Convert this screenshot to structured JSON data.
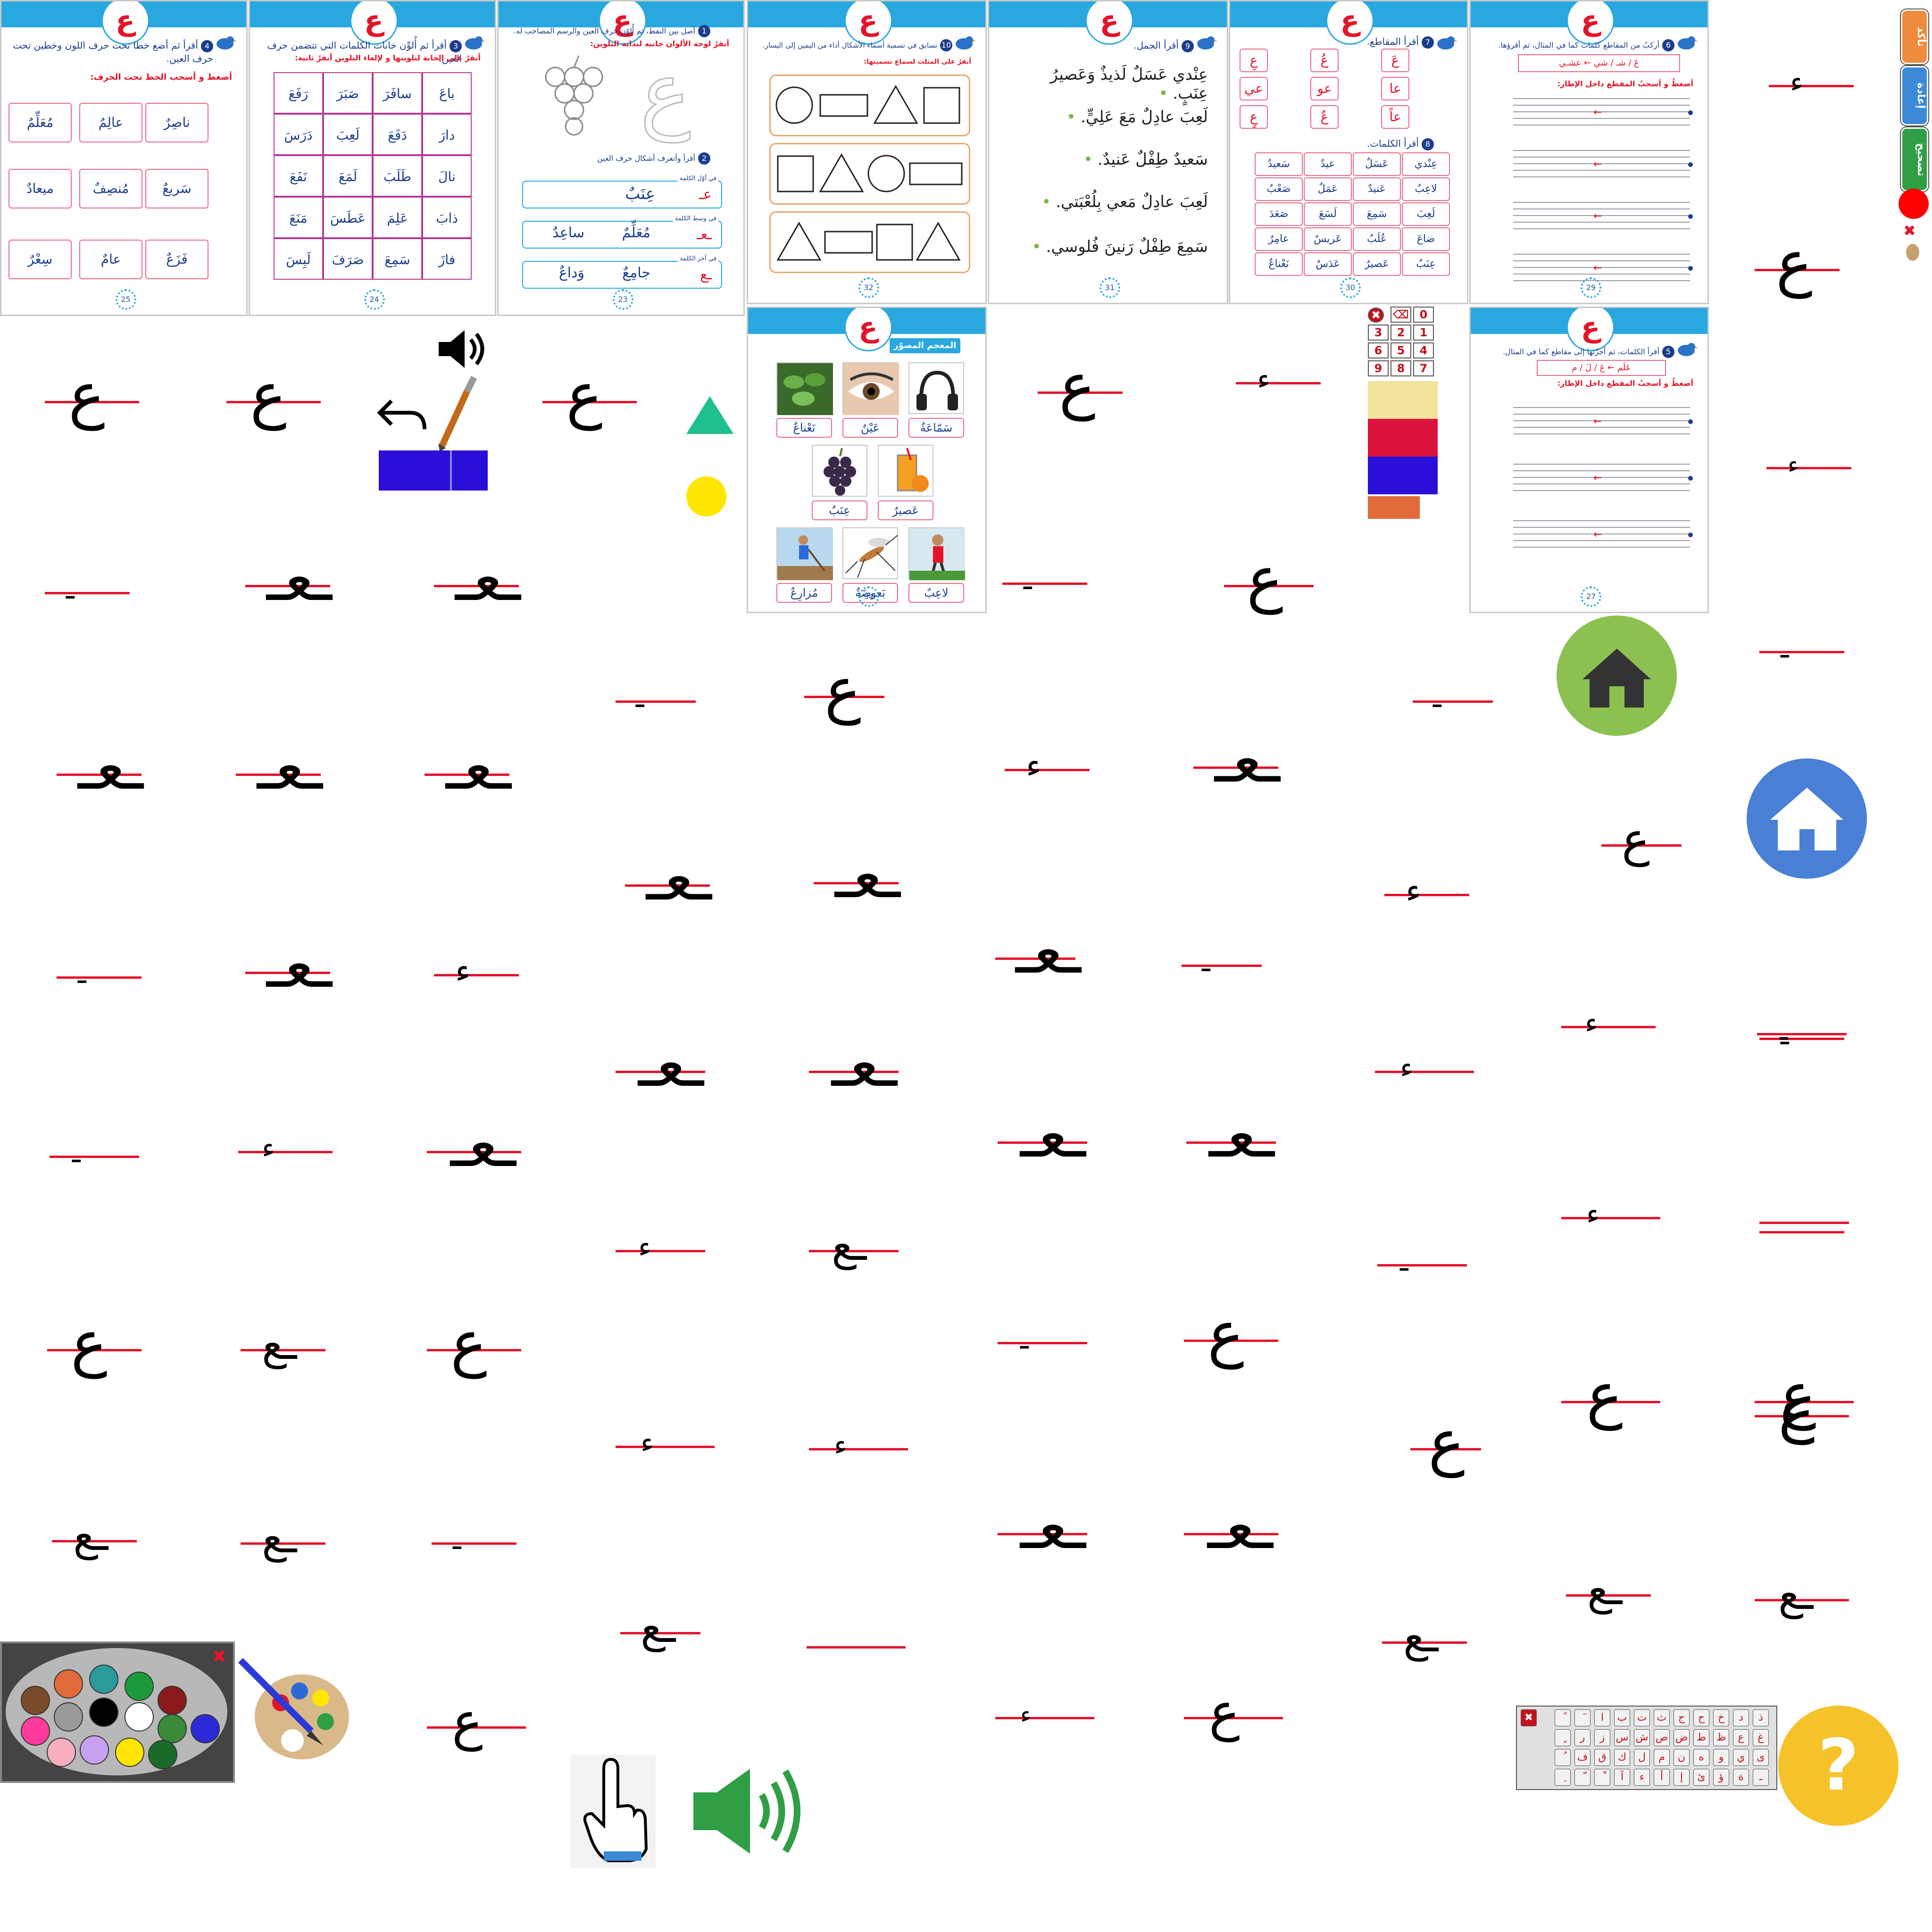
{
  "letter": "ع",
  "pages": [
    {
      "id": "p4",
      "number": "4",
      "instruction": "أقرأ ثم أضع خطا تحت حرف اللون وخطين تحت حرف العين.",
      "sub": "أضغط و أسحب الخط تحت الحرف:",
      "words": [
        "ناصِرٌ",
        "عالِمٌ",
        "مُعَلِّمٌ",
        "سَريعٌ",
        "مُنصِفٌ",
        "ميعادٌ",
        "فَزَعٌ",
        "عامٌ",
        "سِعْرٌ"
      ]
    },
    {
      "id": "p3",
      "number": "3",
      "instruction": "أقرأ ثم أُلوِّن خانات الكلمات التي تتضمن حرف العين.",
      "sub": "أنقرُ على الخانة لتلوينها و لإلغاء التلوين أنقرُ ثانية:",
      "grid": [
        [
          "باعَ",
          "سافَرَ",
          "صَبَرَ",
          "رَفَعَ"
        ],
        [
          "دارَ",
          "دَفَعَ",
          "لَعِبَ",
          "دَرَسَ"
        ],
        [
          "نالَ",
          "طَلَبَ",
          "لَمَعَ",
          "نَفَعَ"
        ],
        [
          "ذابَ",
          "عَلِمَ",
          "عَطَسَ",
          "مَنَعَ"
        ],
        [
          "فازَ",
          "سَمِعَ",
          "صَرَفَ",
          "لَبِسَ"
        ]
      ]
    },
    {
      "id": "p1",
      "number": "1",
      "instruction": "أصل بين النقط، ثم أُلوّن حرف العين والرسم المصاحب له.",
      "sub": "أنقرُ لوحة الألوان جانبه لبداية التلوين:",
      "number2": "2",
      "instruction2": "أقرأ وأتعرف أشكال حرف العين",
      "rows": [
        {
          "label": "في أوّل الكلمة",
          "letter": "عـ",
          "word": "عِنَبٌ"
        },
        {
          "label": "في وسط الكلمة",
          "letter": "ـعـ",
          "words": [
            "مُعَلِّمٌ",
            "ساعِدٌ"
          ]
        },
        {
          "label": "في آخر الكلمة",
          "letter": "ـع",
          "words": [
            "جامِعٌ",
            "وَداعٌ"
          ]
        }
      ]
    },
    {
      "id": "p10",
      "number": "10",
      "instruction": "تسابق في تسمية أسماء الأشكال أداء من اليمين إلى اليسار.",
      "sub": "أنقرُ على المثلث لسماع تسميتها:"
    },
    {
      "id": "p9",
      "number": "9",
      "instruction": "أقرأ الجمل.",
      "sentences": [
        "عِنْدي عَسَلٌ لَذيذٌ وَعَصيرُ عِنَبٍ.",
        "لَعِبَ عادِلٌ مَعَ عَلِيٍّ.",
        "سَعيدٌ طِفْلٌ عَنيدٌ.",
        "لَعِبَ عادِلٌ مَعي بِلُعْبَتي.",
        "سَمِعَ طِفْلٌ رَنينَ فُلوسي."
      ]
    },
    {
      "id": "p7",
      "number": "7",
      "instruction": "أقرأ المقاطع.",
      "syllables": [
        "عَ",
        "عُ",
        "عِ",
        "عا",
        "عو",
        "عي",
        "عاً",
        "عٌ",
        "عٍ"
      ],
      "number2": "8",
      "instruction2": "أقرأ الكلمات.",
      "words": [
        "عِنْدي",
        "عَسَلٌ",
        "عيدٌ",
        "سَعيدٌ",
        "لاعِبٌ",
        "عَنيدٌ",
        "عَمَلٌ",
        "صَعْبٌ",
        "لَعِبَ",
        "سَمِعَ",
        "لَسَعَ",
        "صَعَدَ",
        "ضاعَ",
        "عُلَبٌ",
        "عَريسٌ",
        "عامِرٌ",
        "عِنَبٌ",
        "عَصيرٌ",
        "عَدَسٌ",
        "نَعْناعٌ"
      ]
    },
    {
      "id": "p6",
      "number": "6",
      "instruction": "أركبُ من المقاطع كلمات كما في المثال، ثم أقرؤها.",
      "sub": "أضغطُ و أسحبُ المقطع داخل الإطار:",
      "example": "عَ / شـ / شي  ←  عشـي"
    },
    {
      "id": "p5",
      "number": "5",
      "instruction": "أقرأ الكلمات، ثم أجزّئها إلى مقاطع كما في المثال.",
      "sub": "أضغطُ و أسحبُ المقطع داخل الإطار:",
      "example": "عَلَم ← عَ / لَ / م"
    },
    {
      "id": "dictionary",
      "title": "المعجم المصوّر",
      "items": [
        {
          "label": "سَمّاعَةٌ",
          "icon": "headphones-icon"
        },
        {
          "label": "عَيْنٌ",
          "icon": "eye-icon"
        },
        {
          "label": "نَعْناعٌ",
          "icon": "mint-icon"
        },
        {
          "label": "عَصيرٌ",
          "icon": "juice-icon"
        },
        {
          "label": "عِنَبٌ",
          "icon": "grapes-icon"
        },
        {
          "label": "لاعِبٌ",
          "icon": "player-icon"
        },
        {
          "label": "بَعوضَةٌ",
          "icon": "mosquito-icon"
        },
        {
          "label": "مُزارِعٌ",
          "icon": "farmer-icon"
        }
      ]
    }
  ],
  "side_tabs": [
    {
      "label": "تأكد",
      "color": "#f08a3c"
    },
    {
      "label": "إعادة",
      "color": "#3a8ad8"
    },
    {
      "label": "تصحيح",
      "color": "#2f9e44"
    }
  ],
  "numpad": [
    "0",
    "⌫",
    "1",
    "2",
    "3",
    "4",
    "5",
    "6",
    "7",
    "8",
    "9"
  ],
  "keyboard_rows": [
    [
      "ذ",
      "د",
      "خ",
      "ح",
      "ج",
      "ث",
      "ت",
      "ب",
      "ا",
      "ٓ",
      "ً"
    ],
    [
      "غ",
      "ع",
      "ظ",
      "ط",
      "ض",
      "ص",
      "ش",
      "س",
      "ز",
      "ر",
      "ٍ"
    ],
    [
      "ى",
      "ي",
      "و",
      "ه",
      "ن",
      "م",
      "ل",
      "ك",
      "ق",
      "ف",
      "ُ"
    ],
    [
      "ـ",
      "ة",
      "ؤ",
      "ئ",
      "إ",
      "أ",
      "ء",
      "آ",
      "ْ",
      "ّ",
      "ِ"
    ]
  ],
  "colors": {
    "accent_blue": "#29a8e0",
    "red": "#e4132b",
    "home_green": "#8cc152",
    "home_blue": "#4a7fd6",
    "help_yellow": "#f5c22a",
    "swatch_yellow": "#f2e49a",
    "swatch_red": "#dc143c",
    "swatch_blue": "#2a0fd8",
    "swatch_orange": "#e06a3a",
    "triangle": "#1fbf8f",
    "circle": "#ffe600",
    "speaker_green": "#2f9e44"
  },
  "palette_colors": [
    "#7a4b2a",
    "#e06a3a",
    "#2a9a9a",
    "#1a9a3a",
    "#8a1a1a",
    "#ff3a9a",
    "#9a9a9a",
    "#000000",
    "#ffffff",
    "#3a8a3a",
    "#2a2ad8",
    "#f7b0c0",
    "#c8a0f0",
    "#ffe600",
    "#1a6a2a"
  ],
  "icons": {
    "speaker": "speaker-icon",
    "undo": "undo-icon",
    "brush": "brush-icon",
    "home": "home-icon",
    "help": "help-icon",
    "hand": "hand-pointer-icon",
    "palette": "palette-icon",
    "close": "close-icon"
  },
  "help_symbol": "?",
  "close_symbol": "✖",
  "trace_glyphs": [
    "ع",
    "عـ",
    "ـعـ",
    "ـع",
    "ـ",
    "ۦ",
    "ء"
  ]
}
